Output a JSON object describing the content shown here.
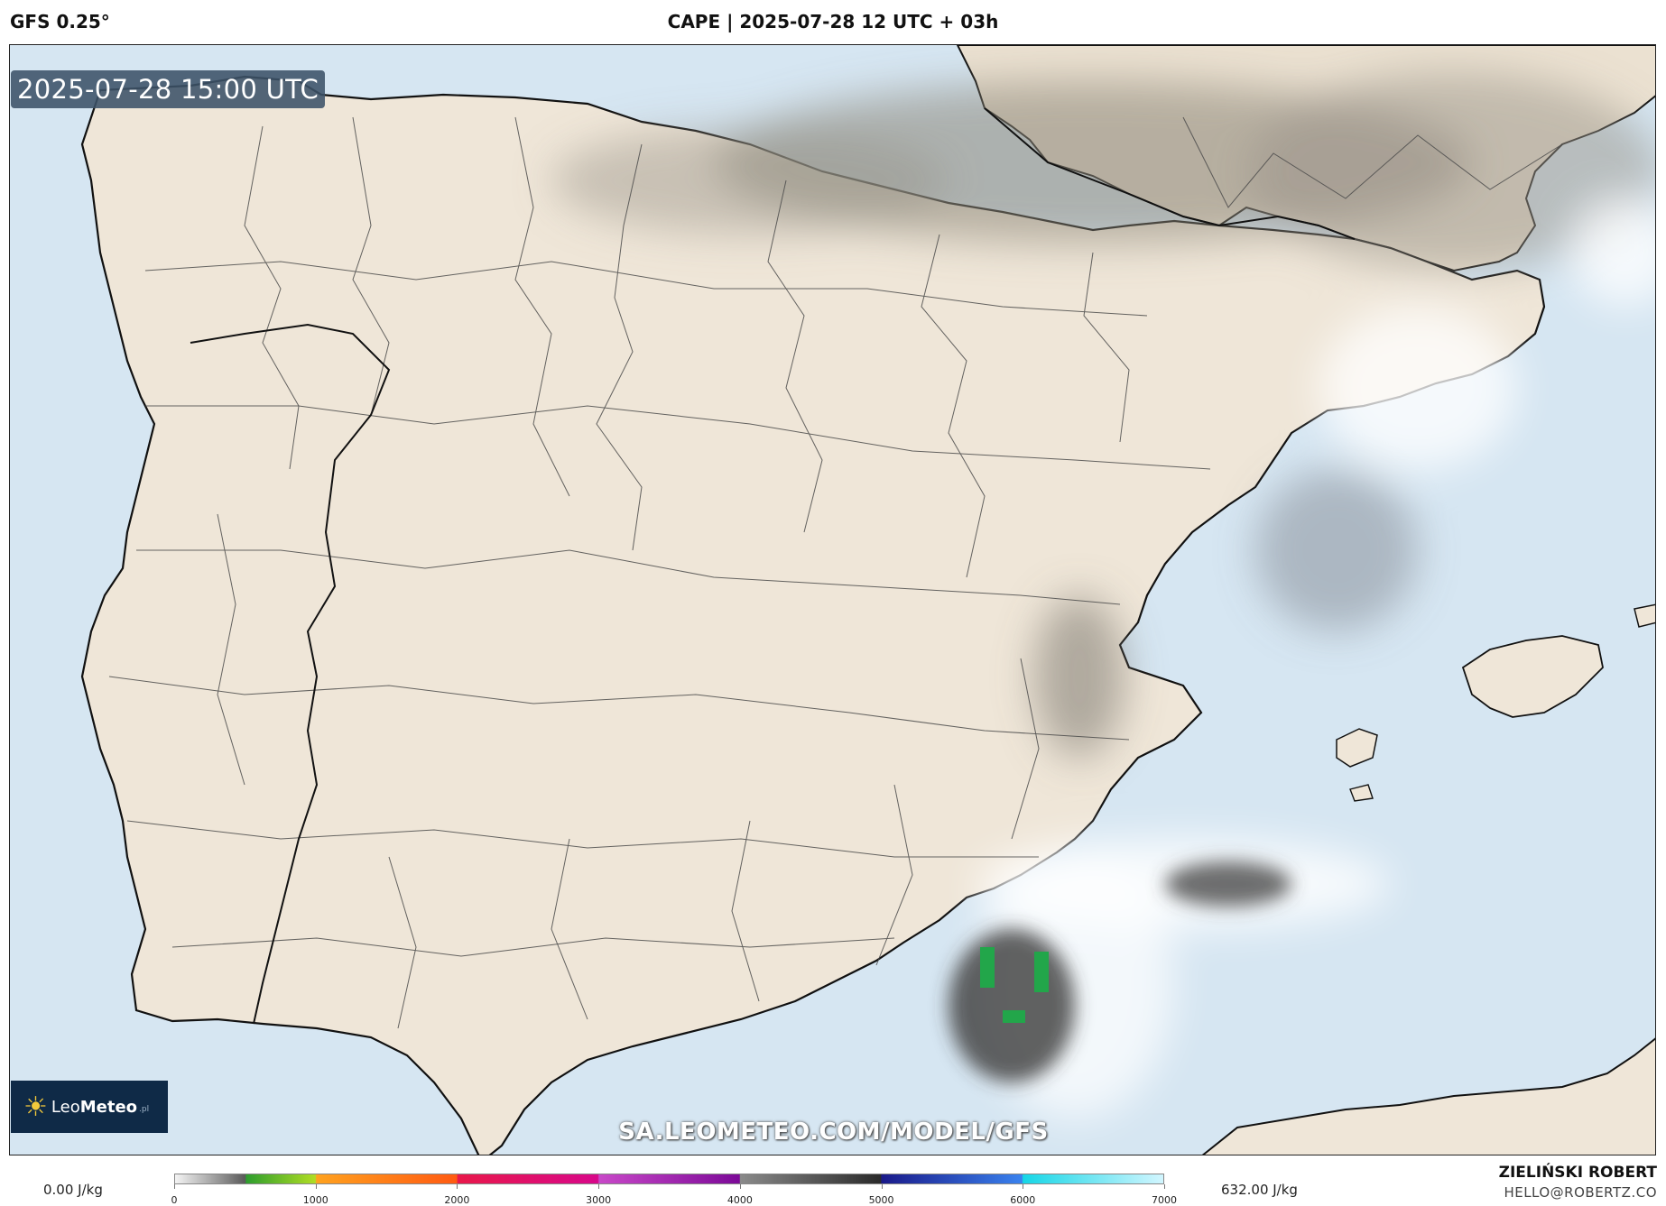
{
  "header": {
    "model": "GFS 0.25°",
    "title": "CAPE | 2025-07-28 12 UTC + 03h"
  },
  "map": {
    "timestamp": "2025-07-28 15:00 UTC",
    "watermark": "SA.LEOMETEO.COM/MODEL/GFS",
    "logo": {
      "leo": "Leo",
      "meteo": "Meteo",
      "suffix": ".pl"
    },
    "colors": {
      "sea": "#d6e6f2",
      "land": "#efe6d8",
      "border": "#111111"
    }
  },
  "legend": {
    "min_label": "0.00 J/kg",
    "max_label": "632.00 J/kg",
    "ticks": [
      "0",
      "1000",
      "2000",
      "3000",
      "4000",
      "5000",
      "6000",
      "7000"
    ]
  },
  "credit": {
    "name": "ZIELIŃSKI ROBERT",
    "email": "HELLO@ROBERTZ.CO"
  }
}
